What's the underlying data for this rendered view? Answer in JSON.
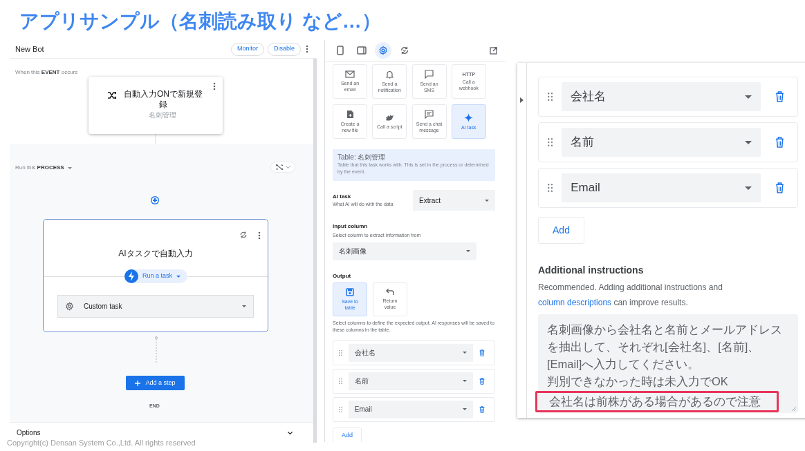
{
  "slide_title": "アプリサンプル（名刺読み取り など…）",
  "bot_editor": {
    "title": "New Bot",
    "buttons": [
      "Monitor",
      "Disable"
    ],
    "event_label": "When this **EVENT** occurs",
    "event_card": {
      "title": "自動入力ONで新規登録",
      "table": "名刺管理"
    },
    "process_label": "Run this **PROCESS**",
    "process_linked": false,
    "step_card": {
      "title": "AIタスクで自動入力",
      "task_type": "Run a task",
      "task": "Custom task"
    },
    "add_step": "Add a step",
    "end": "END",
    "options": "Options"
  },
  "task_panel": {
    "toolbar": [
      {
        "kind": "phone",
        "selected": false
      },
      {
        "kind": "tablet",
        "selected": false
      },
      {
        "kind": "gear",
        "selected": true
      },
      {
        "kind": "sync",
        "selected": false
      }
    ],
    "actions": [
      {
        "kind": "email",
        "label": "Send an email",
        "selected": false
      },
      {
        "kind": "bell",
        "label": "Send a notification",
        "selected": false
      },
      {
        "kind": "sms",
        "label": "Send an SMS",
        "selected": false
      },
      {
        "kind": "webhook",
        "icon_text": "HTTP",
        "label": "Call a webhook",
        "selected": false
      },
      {
        "kind": "file",
        "label": "Create a new file",
        "selected": false
      },
      {
        "kind": "script",
        "label": "Call a script",
        "selected": false
      },
      {
        "kind": "chat",
        "label": "Send a chat message",
        "selected": false
      },
      {
        "kind": "ai",
        "label": "AI task",
        "selected": true
      }
    ],
    "table_info": {
      "title": "Table: 名刺管理",
      "description": "Table that this task works with. This is set in the process or determined by the event."
    },
    "ai_task": {
      "label": "AI task",
      "hint": "What AI will do with the data",
      "value": "Extract"
    },
    "input_column": {
      "label": "Input column",
      "hint": "Select column to extract information from",
      "value": "名刺画像"
    },
    "output": {
      "label": "Output",
      "options": [
        {
          "kind": "save",
          "label": "Save to table",
          "selected": true
        },
        {
          "kind": "return",
          "label": "Return value",
          "selected": false
        }
      ],
      "hint": "Select columns to define the expected output. AI responses will be saved to these columns in the table.",
      "columns": [
        "会社名",
        "名前",
        "Email"
      ],
      "add": "Add"
    }
  },
  "zoomed_panel": {
    "columns": [
      "会社名",
      "名前",
      "Email"
    ],
    "add": "Add",
    "instructions": {
      "label": "Additional instructions",
      "hint_before": "Recommended. Adding additional instructions and",
      "link": "column descriptions",
      "hint_after": "can improve results.",
      "lines": [
        {
          "text": "名刺画像から会社名と名前とメールアドレス",
          "highlighted": false
        },
        {
          "text": "を抽出して、それぞれ[会社名]、[名前]、",
          "highlighted": false
        },
        {
          "text": "[Email]へ入力してください。",
          "highlighted": false
        },
        {
          "text": "判別できなかった時は未入力でOK",
          "highlighted": false
        },
        {
          "text": "会社名は前株がある場合があるので注意",
          "highlighted": true
        }
      ]
    }
  },
  "footer": "Copyright(c) Densan System Co.,Ltd. All rights reserved"
}
